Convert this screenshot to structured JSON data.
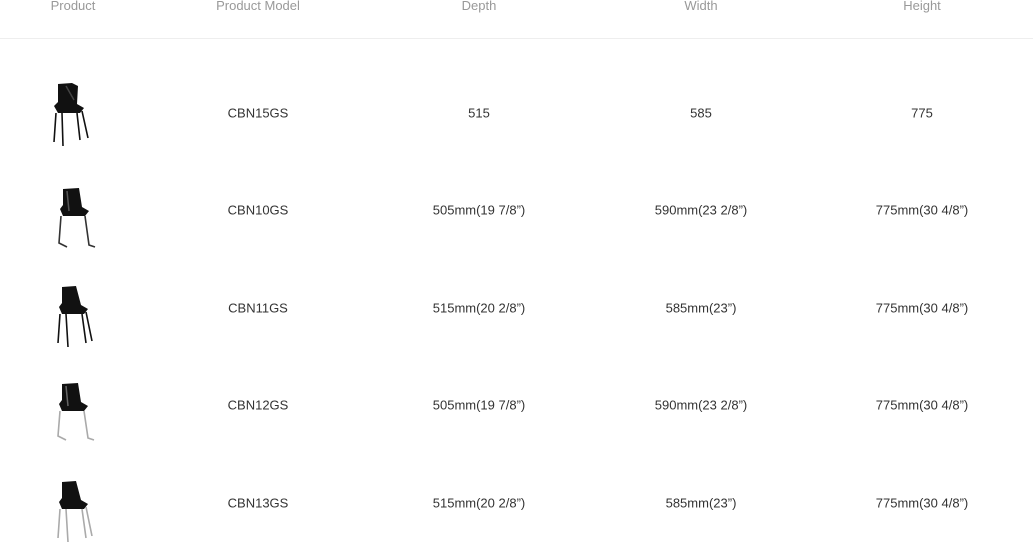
{
  "table": {
    "headers": [
      "Product",
      "Product Model",
      "Depth",
      "Width",
      "Height"
    ],
    "rows": [
      {
        "image": "chair-four-leg-black-icon",
        "model": "CBN15GS",
        "depth": "515",
        "width": "585",
        "height": "775"
      },
      {
        "image": "chair-sled-base-icon",
        "model": "CBN10GS",
        "depth": "505mm(19 7/8”)",
        "width": "590mm(23 2/8”)",
        "height": "775mm(30 4/8”)"
      },
      {
        "image": "chair-four-leg-black-icon",
        "model": "CBN11GS",
        "depth": "515mm(20 2/8”)",
        "width": "585mm(23”)",
        "height": "775mm(30 4/8”)"
      },
      {
        "image": "chair-sled-base-chrome-icon",
        "model": "CBN12GS",
        "depth": "505mm(19 7/8”)",
        "width": "590mm(23 2/8”)",
        "height": "775mm(30 4/8”)"
      },
      {
        "image": "chair-four-leg-chrome-icon",
        "model": "CBN13GS",
        "depth": "515mm(20 2/8”)",
        "width": "585mm(23”)",
        "height": "775mm(30 4/8”)"
      }
    ]
  }
}
